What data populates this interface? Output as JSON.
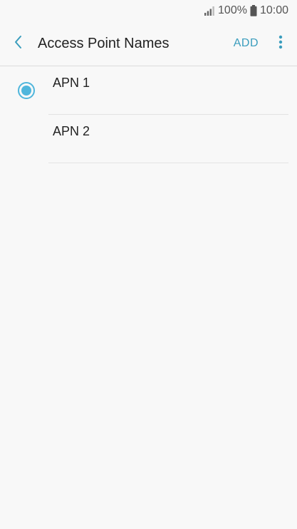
{
  "status_bar": {
    "battery": "100%",
    "time": "10:00"
  },
  "app_bar": {
    "title": "Access Point Names",
    "add_label": "ADD"
  },
  "apn_list": [
    {
      "label": "APN 1",
      "selected": true
    },
    {
      "label": "APN 2",
      "selected": false
    }
  ],
  "colors": {
    "accent": "#3a9dbd",
    "radio_selected": "#4fb6dc"
  },
  "icons": {
    "back": "chevron-left-icon",
    "more": "more-vertical-icon",
    "signal": "signal-icon",
    "battery": "battery-icon"
  }
}
